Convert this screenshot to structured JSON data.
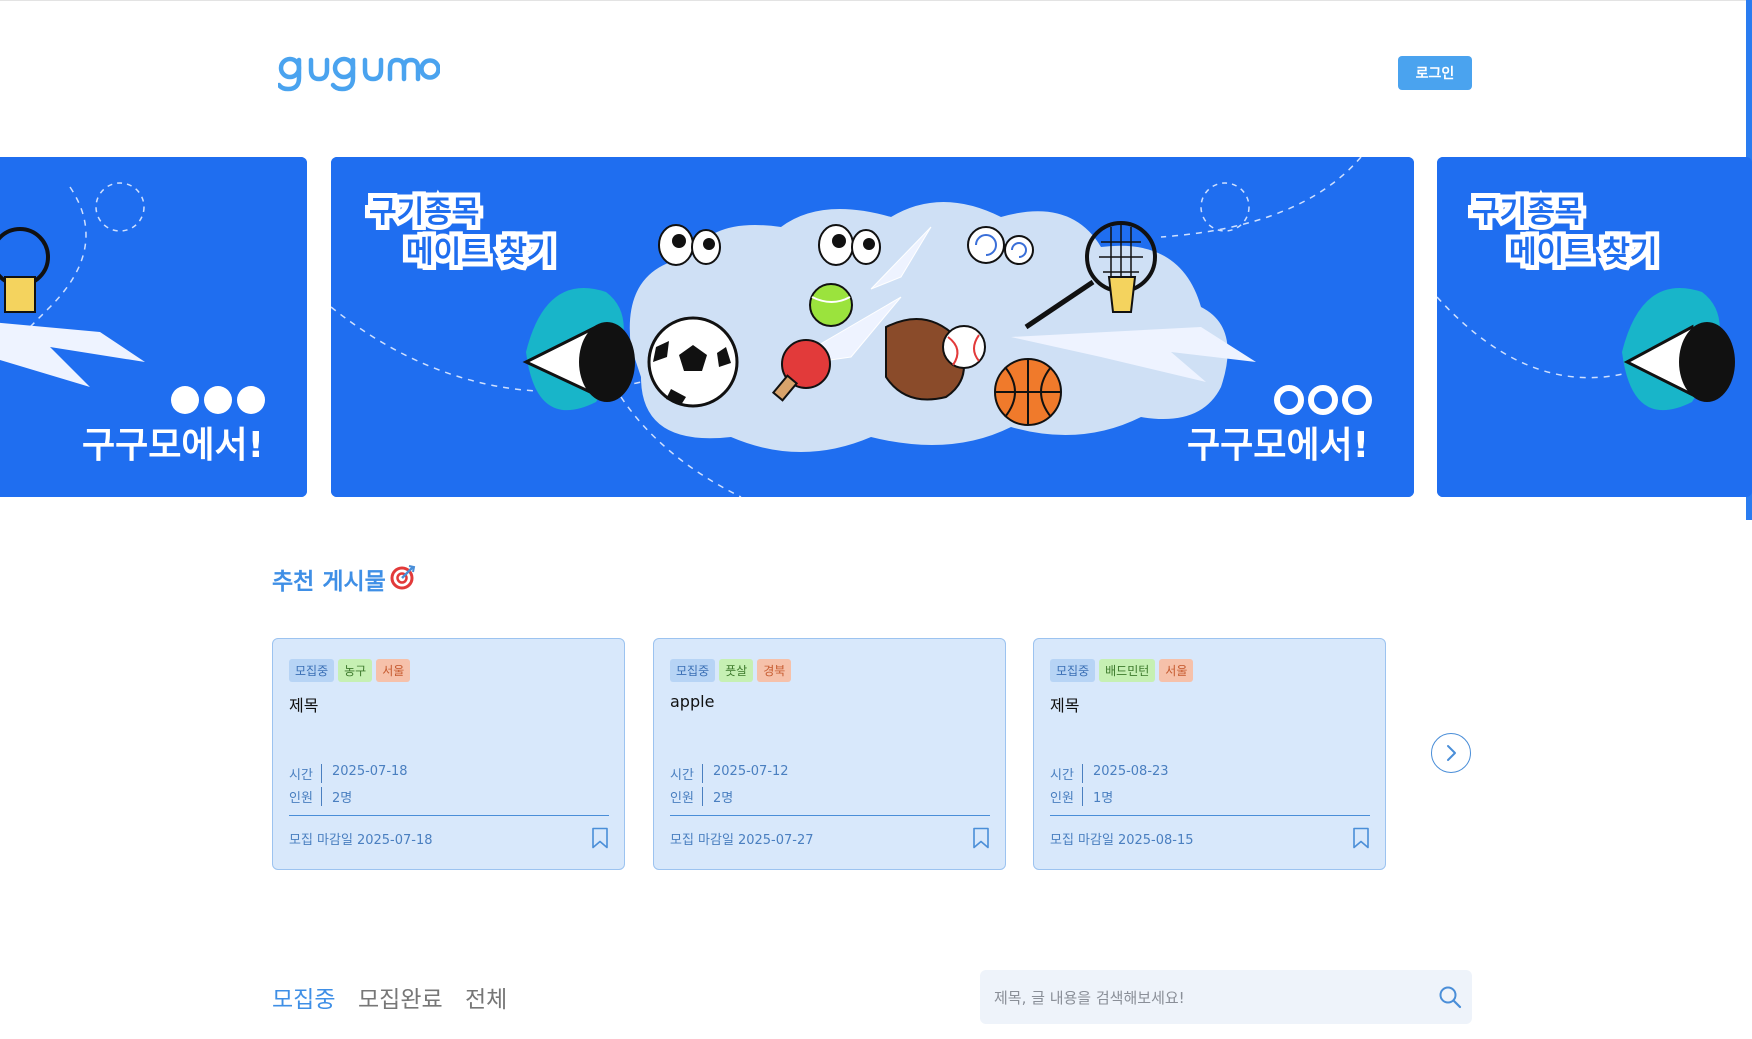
{
  "header": {
    "logo_text": "gugumo",
    "login_label": "로그인"
  },
  "banner": {
    "headline_1": "구기종목",
    "headline_2": "메이트 찾기",
    "tagline": "구구모에서!"
  },
  "recommended": {
    "title": "추천 게시물",
    "icon": "target-icon",
    "cards": [
      {
        "status": "모집중",
        "sport": "농구",
        "region": "서울",
        "title": "제목",
        "time_label": "시간",
        "time": "2025-07-18",
        "people_label": "인원",
        "people": "2명",
        "deadline_label": "모집 마감일",
        "deadline": "2025-07-18"
      },
      {
        "status": "모집중",
        "sport": "풋살",
        "region": "경북",
        "title": "apple",
        "time_label": "시간",
        "time": "2025-07-12",
        "people_label": "인원",
        "people": "2명",
        "deadline_label": "모집 마감일",
        "deadline": "2025-07-27"
      },
      {
        "status": "모집중",
        "sport": "배드민턴",
        "region": "서울",
        "title": "제목",
        "time_label": "시간",
        "time": "2025-08-23",
        "people_label": "인원",
        "people": "1명",
        "deadline_label": "모집 마감일",
        "deadline": "2025-08-15"
      }
    ]
  },
  "tabs": [
    "모집중",
    "모집완료",
    "전체"
  ],
  "search": {
    "placeholder": "제목, 글 내용을 검색해보세요!"
  },
  "colors": {
    "brand": "#4aa3ef",
    "banner_bg": "#1f6ef0",
    "card_bg": "#d8e8fb",
    "accent_text": "#3f8fe6"
  }
}
